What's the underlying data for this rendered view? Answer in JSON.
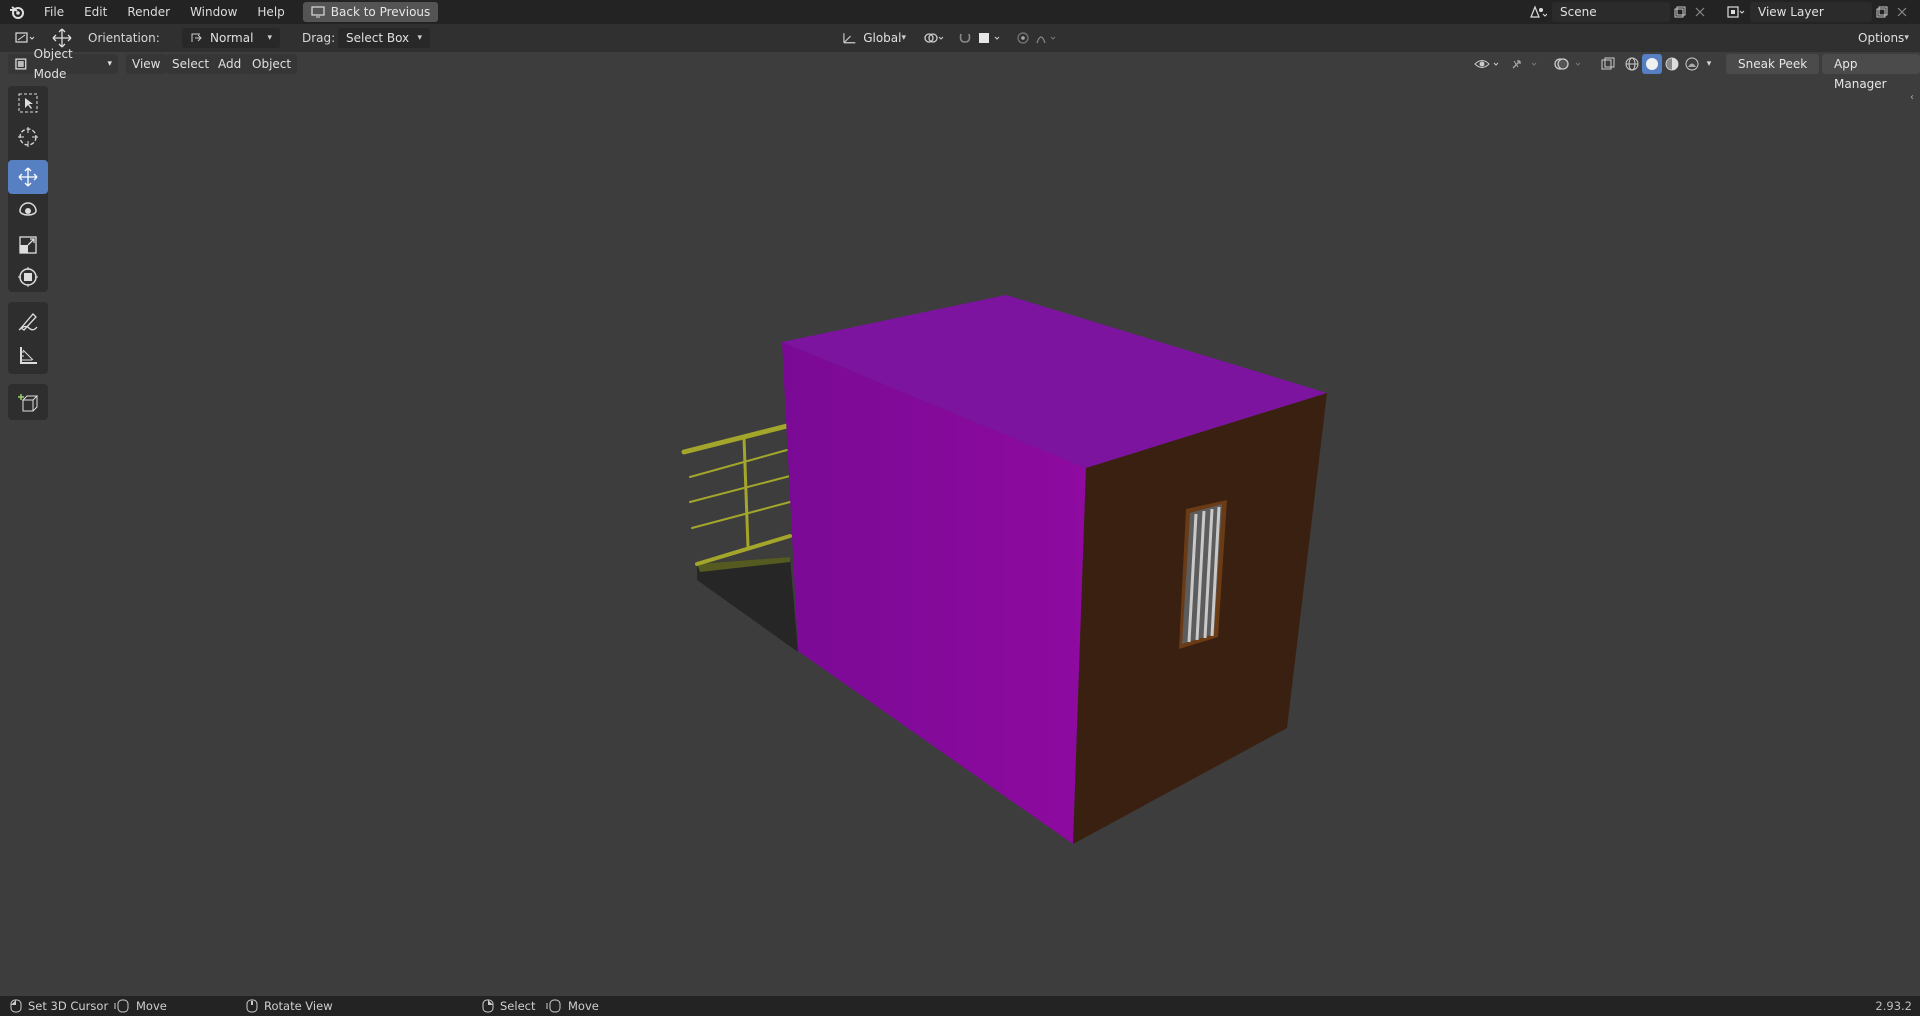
{
  "menu": {
    "items": [
      "File",
      "Edit",
      "Render",
      "Window",
      "Help"
    ],
    "back_button": "Back to Previous"
  },
  "scene": {
    "name": "Scene"
  },
  "view_layer": {
    "name": "View Layer"
  },
  "header": {
    "orientation_label": "Orientation:",
    "orientation_value": "Normal",
    "drag_label": "Drag:",
    "drag_value": "Select Box",
    "transform_orientation": "Global",
    "options": "Options"
  },
  "viewport_header": {
    "mode": "Object Mode",
    "view": "View",
    "select": "Select",
    "add": "Add",
    "object": "Object",
    "sneak_peek": "Sneak Peek",
    "app_manager": "App Manager"
  },
  "toolbar": {
    "tools": [
      "select-box",
      "cursor",
      "move",
      "rotate",
      "scale",
      "transform",
      "annotate",
      "measure",
      "add-cube"
    ],
    "active": "move"
  },
  "colors": {
    "accent": "#5680c2",
    "cube_front": "#8a0b99",
    "cube_top": "#7d14a0",
    "cube_side": "#3a2010",
    "railing": "#a3a62a"
  },
  "statusbar": {
    "set_cursor": "Set 3D Cursor",
    "move1": "Move",
    "rotate_view": "Rotate View",
    "select": "Select",
    "move2": "Move",
    "version": "2.93.2"
  }
}
